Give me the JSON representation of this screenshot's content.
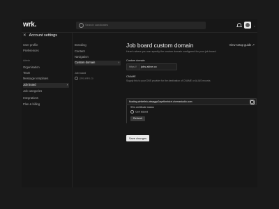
{
  "app": {
    "logo": "wrk."
  },
  "search": {
    "placeholder": "Search candidates"
  },
  "header": {
    "caret": "⌄"
  },
  "left_nav": {
    "title": "Account settings",
    "close_glyph": "✕",
    "items": [
      {
        "label": "User profile"
      },
      {
        "label": "Preferences"
      }
    ],
    "section": "Admin",
    "admin_items": [
      {
        "label": "Organisation"
      },
      {
        "label": "Team"
      },
      {
        "label": "Message templates"
      },
      {
        "label": "Job board",
        "active": true
      },
      {
        "label": "Job categories"
      },
      {
        "label": "Integrations"
      },
      {
        "label": "Plan & billing"
      }
    ],
    "chevron": "›"
  },
  "sub_nav": {
    "items": [
      {
        "label": "Branding"
      },
      {
        "label": "Content"
      },
      {
        "label": "Navigation"
      },
      {
        "label": "Custom domain",
        "active": true
      }
    ],
    "job_board_label": "Job board",
    "job_board_domain": "jobs.akine.co",
    "chevron": "›"
  },
  "main": {
    "title": "Job board custom domain",
    "view_guide": "View setup guide ↗",
    "description": "Here's where you can specify the custom domain configured for your job board.",
    "custom_domain": {
      "label": "Custom domain",
      "prefix": "https://",
      "value": "jobs.akine.co"
    },
    "cname": {
      "label": "CNAME",
      "help": "Supply this to your DNS provider for the destination of CNAME or ALIAS records",
      "value": "floating-whitefish-wtaaggx2ayefkmhtcrt.cherrastudio.com"
    },
    "ssl": {
      "title": "SSL certificate status",
      "status": "Cert issued",
      "refresh": "Refresh"
    },
    "save": "Save changes"
  }
}
